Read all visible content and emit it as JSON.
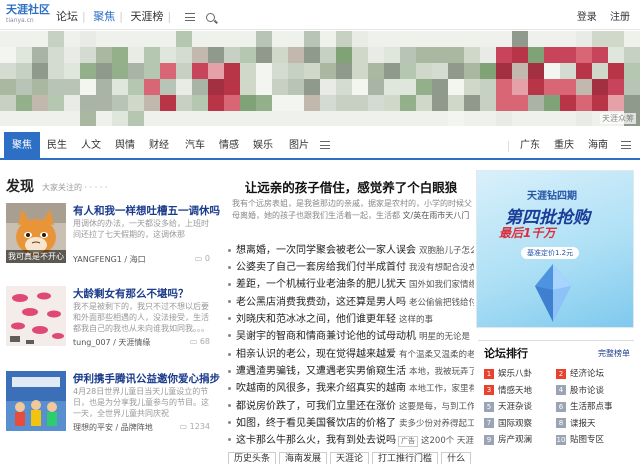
{
  "topbar": {
    "logo_text": "天涯社区",
    "logo_sub": "tianya.cn",
    "nav": [
      "论坛",
      "聚焦",
      "天涯榜"
    ],
    "login": "登录",
    "register": "注册"
  },
  "banner": {
    "label": "天涯众筹"
  },
  "category_tabs": [
    "聚焦",
    "民生",
    "人文",
    "舆情",
    "财经",
    "汽车",
    "情感",
    "娱乐",
    "图片"
  ],
  "region_tabs": [
    "广东",
    "重庆",
    "海南"
  ],
  "discover": {
    "title": "发现",
    "subtitle": "大家关注的 · · · · ·",
    "items": [
      {
        "title": "有人和我一样想吐槽五一调休吗",
        "desc": "用调休的办法，一天都没多给，上班时间还拉了七天假期的，这调休那",
        "user": "YANGFENG1",
        "board": "海口",
        "count": "0",
        "caption": "我可真是不开心"
      },
      {
        "title": "大龄剩女有那么不堪吗？",
        "desc": "我不是被剩下的，我只不过不想以后要和外面那些相遇的人，没法接受，生活都我自己的我也从未向谁我如同我。。。",
        "user": "tung_007",
        "board": "天涯情缘",
        "count": "68",
        "caption": ""
      },
      {
        "title": "伊利携手腾讯公益邀你爱心捐步",
        "desc": "4月28日世界儿童日当天儿童设立的节日，也是为分享我儿童参与的节目。这一天，全世界儿童共同庆祝",
        "user": "理想的平安",
        "board": "品牌阵地",
        "count": "1234",
        "caption": ""
      }
    ]
  },
  "headline": {
    "title": "让远亲的孩子借住，感觉养了个白眼狼",
    "desc": "我有个远房表姐，是我爸那边的亲戚，据家是农村的，小学的时候父母离婚，她的孩子也跟我们生活着一起，生活都",
    "source": "文/英在雨市天八门T"
  },
  "news": [
    {
      "a": "想离婚，一次同学聚会被老公一家人误会",
      "b": "双胞胎儿子怎么办"
    },
    {
      "a": "公婆卖了自己一套房给我们付半成首付",
      "b": "我没有想配合没衣"
    },
    {
      "a": "差距，一个机械行业老油条的肥儿犹天",
      "b": "国外如我们家情缘"
    },
    {
      "a": "老公黑店消费我费劲，这还算是男人吗",
      "b": "老公偷偷把钱给付了"
    },
    {
      "a": "刘晓庆和范冰冰之间，他们谁更年轻",
      "b": "这样的事"
    },
    {
      "a": "吴谢宇的智商和情商兼讨论他的试母动机",
      "b": "明星的无论是"
    },
    {
      "a": "相亲认识的老公，现在觉得越来越爱",
      "b": "有个温柔又温柔的老公"
    },
    {
      "a": "遭遇渣男骗钱，又遭遇老实男偷窥生活",
      "b": "本地，我被玩弄了"
    },
    {
      "a": "吹越南的风很多，我来介绍真实的越南",
      "b": "本地工作，家里有了"
    },
    {
      "a": "都说房价跌了，可我们立里还在涨价",
      "b": "这要是每，与到工作"
    },
    {
      "a": "如图，终于看见美国餐饮店的价格了",
      "b": "卖多少份对养得起工人"
    },
    {
      "a": "这卡那么牛那么火，我有到处去说吗",
      "b": "这200个 天涯招"
    }
  ],
  "news_tag": "广告",
  "bottom_tags": [
    "历史头条",
    "海南发展",
    "天涯论",
    "打工推行门槛",
    "什么"
  ],
  "ad": {
    "brand": "天涯钻四期",
    "big": "第四批抢购",
    "big2": "最后1千万",
    "price": "基准定价1.2元"
  },
  "rank": {
    "title": "论坛排行",
    "more": "完整榜单",
    "items": [
      {
        "n": "1",
        "label": "娱乐八卦"
      },
      {
        "n": "2",
        "label": "经济论坛"
      },
      {
        "n": "3",
        "label": "情感天地"
      },
      {
        "n": "4",
        "label": "股市论谈"
      },
      {
        "n": "5",
        "label": "天涯杂谈"
      },
      {
        "n": "6",
        "label": "生活那点事"
      },
      {
        "n": "7",
        "label": "国际观察"
      },
      {
        "n": "8",
        "label": "谍报天"
      },
      {
        "n": "9",
        "label": "房产观澜"
      },
      {
        "n": "10",
        "label": "貼图专区"
      }
    ]
  },
  "colors": {
    "accent": "#2c6fc5",
    "rank_hot": "#e8412e",
    "rank_normal": "#9aa4b2"
  }
}
